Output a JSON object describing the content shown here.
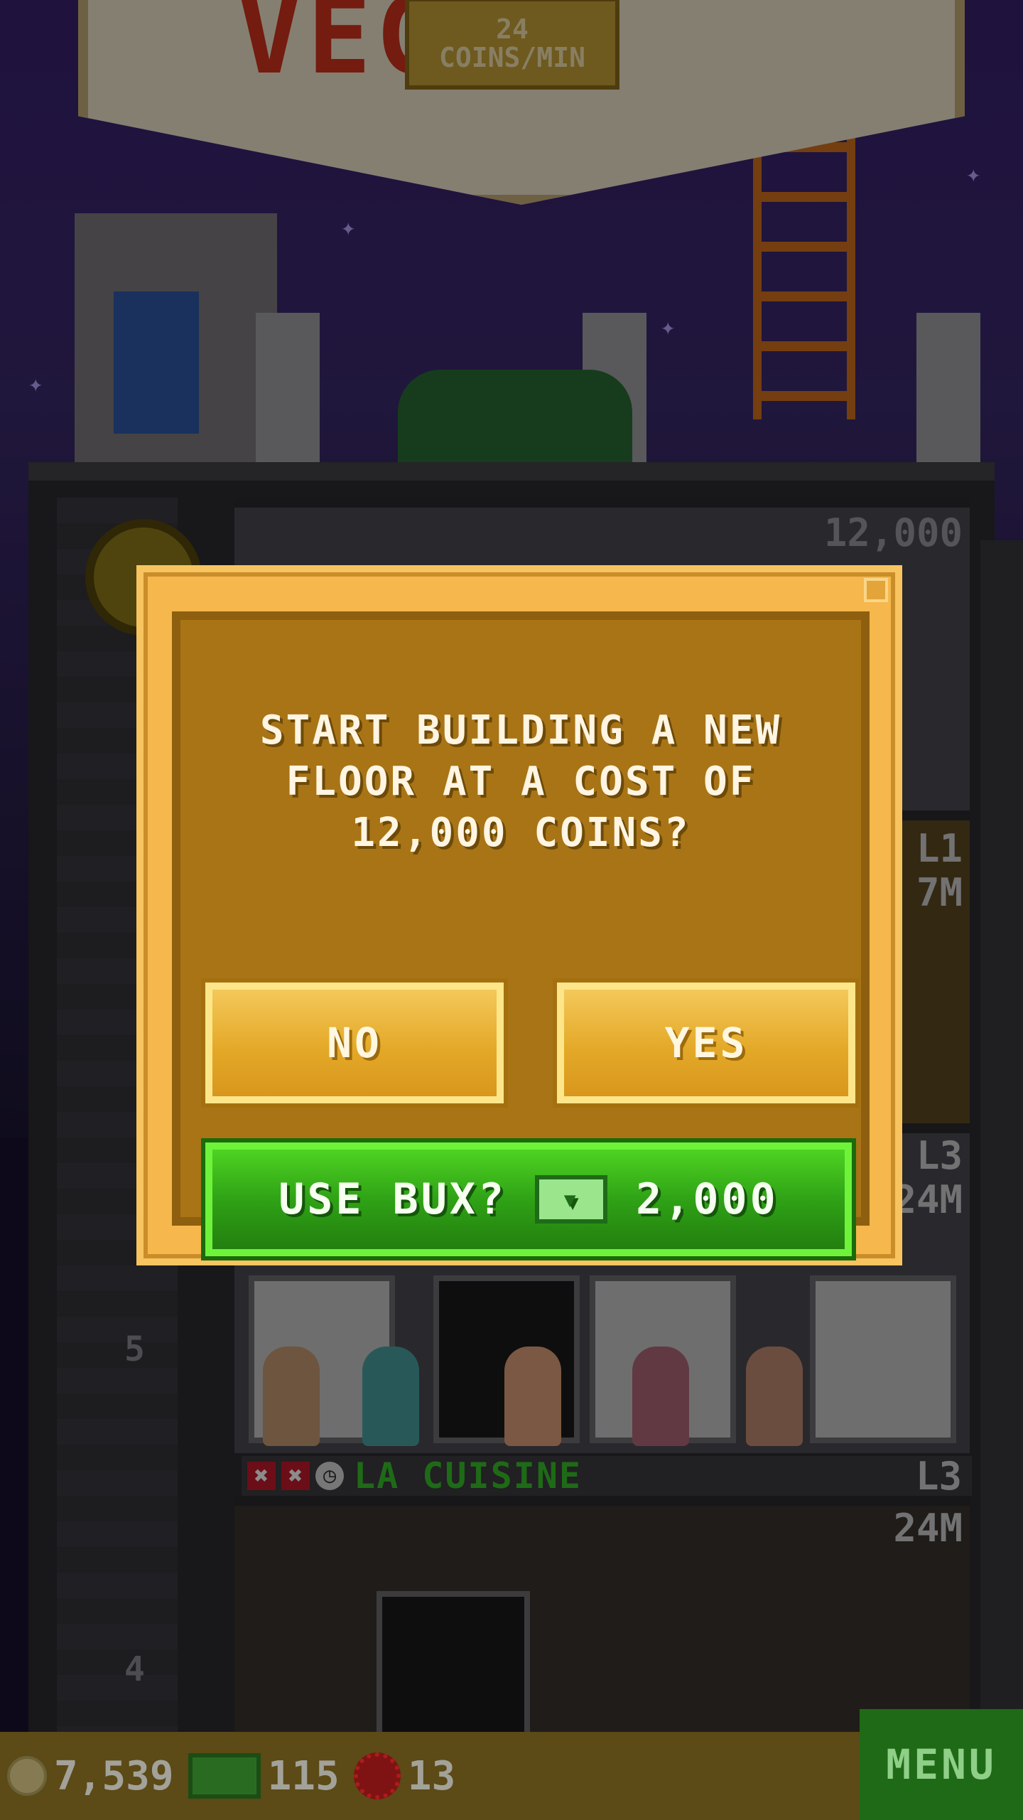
{
  "sign": {
    "letters": "VEGAS",
    "rate_value": "24",
    "rate_unit": "COINS/MIN"
  },
  "tower": {
    "new_floor_cost_label": "12,000",
    "floors": [
      {
        "level": "L1",
        "income": "7M"
      },
      {
        "level": "L3",
        "income": "24M"
      },
      {
        "number": "5"
      },
      {
        "name": "LA CUISINE",
        "level": "L3",
        "income": "24M",
        "number": "4"
      }
    ]
  },
  "dialog": {
    "message": "START BUILDING A NEW FLOOR AT A COST OF 12,000 COINS?",
    "no_label": "NO",
    "yes_label": "YES",
    "bux_label": "USE BUX?",
    "bux_cost": "2,000"
  },
  "status_bar": {
    "coins": "7,539",
    "bux": "115",
    "tokens": "13",
    "menu_label": "MENU"
  },
  "colors": {
    "dialog_gold": "#a87416",
    "bux_green": "#2fa216",
    "shop_name_green": "#39c12a"
  },
  "icons": [
    "coin-icon",
    "bux-icon",
    "vip-token-icon",
    "elevator-icon",
    "clock-icon",
    "x-icon"
  ]
}
